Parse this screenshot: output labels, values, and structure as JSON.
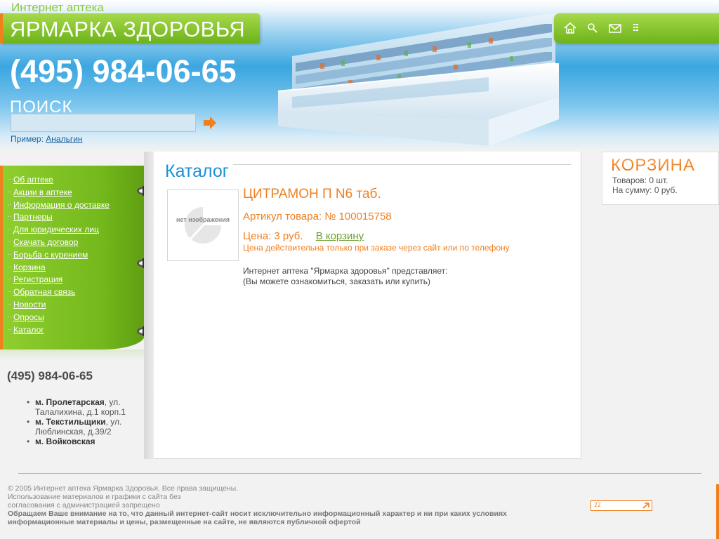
{
  "header": {
    "top_caption": "Интернет аптека",
    "logo_text": "ЯРМАРКА ЗДОРОВЬЯ",
    "phone": "(495) 984-06-65",
    "search": {
      "label": "ПОИСК",
      "value": "",
      "example_prefix": "Пример:",
      "example_link": "Анальгин"
    },
    "icons": [
      "home-icon",
      "search-icon",
      "mail-icon",
      "sitemap-icon"
    ]
  },
  "menu": {
    "items": [
      "Об аптеке",
      "Акции в аптеке",
      "Информация о доставке",
      "Партнеры",
      "Для юридических лиц",
      "Скачать договор",
      "Борьба с курением",
      "Корзина",
      "Регистрация",
      "Обратная связь",
      "Новости",
      "Опросы",
      "Каталог"
    ]
  },
  "contacts": {
    "phone": "(495) 984-06-65",
    "locations": [
      {
        "station": "м. Пролетарская",
        "address": ", ул. Талалихина, д.1 корп.1"
      },
      {
        "station": "м. Текстильщики",
        "address": ", ул. Люблинская, д.39/2"
      },
      {
        "station": "м. Войковская",
        "address": ""
      }
    ]
  },
  "main": {
    "title": "Каталог",
    "no_image_text": "нет изображения",
    "product": {
      "name": "ЦИТРАМОН П N6 таб.",
      "sku": "Артикул товара: № 100015758",
      "price": "Цена: 3 руб.",
      "add_to_cart": "В корзину",
      "price_note": "Цена действительна только при заказе через сайт или по телефону",
      "desc_line1": "Интернет аптека \"Ярмарка здоровья\" представляет:",
      "desc_line2": "(Вы можете ознакомиться, заказать или купить)"
    }
  },
  "cart": {
    "title": "КОРЗИНА",
    "items_line": "Товаров: 0 шт.",
    "sum_line": "На сумму: 0 руб."
  },
  "footer": {
    "line1": "© 2005 Интернет аптека Ярмарка Здоровья. Все права защищены.",
    "line2": "Использование материалов и графики с сайта без",
    "line3": "согласования с администрацией запрещено",
    "notice": "Обращаем Ваше внимание на то, что данный интернет-сайт носит исключительно информационный характер и ни при каких условиях информационные материалы и цены, размещенные на сайте, не являются публичной офертой",
    "counter_text": "22"
  },
  "colors": {
    "green": "#7cc12a",
    "orange": "#f07f1e",
    "blue": "#1d8fd8"
  }
}
